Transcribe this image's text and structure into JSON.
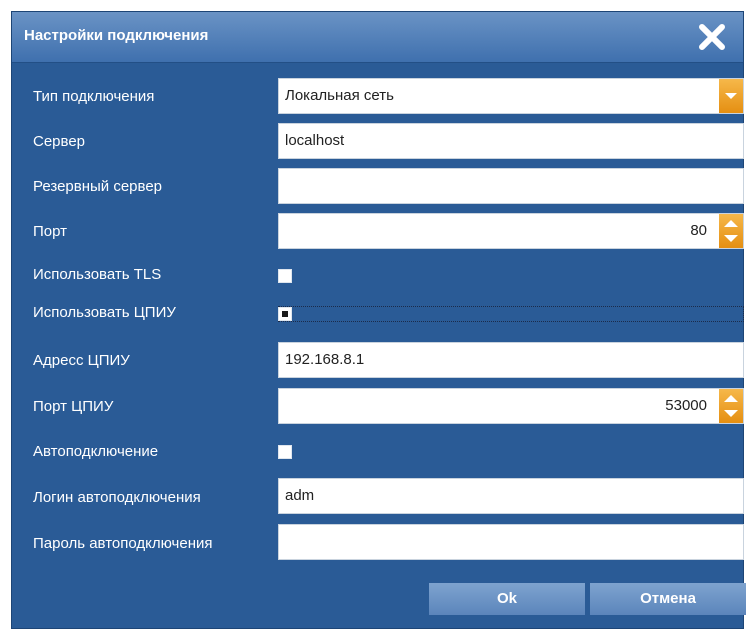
{
  "dialog": {
    "title": "Настройки подключения"
  },
  "fields": {
    "connection_type": {
      "label": "Тип подключения",
      "value": "Локальная сеть"
    },
    "server": {
      "label": "Сервер",
      "value": "localhost"
    },
    "backup_server": {
      "label": "Резервный сервер",
      "value": ""
    },
    "port": {
      "label": "Порт",
      "value": "80"
    },
    "use_tls": {
      "label": "Использовать TLS",
      "checked": false
    },
    "use_cpiu": {
      "label": "Использовать ЦПИУ",
      "checked": true
    },
    "cpiu_address": {
      "label": "Адресс ЦПИУ",
      "value": "192.168.8.1"
    },
    "cpiu_port": {
      "label": "Порт ЦПИУ",
      "value": "53000"
    },
    "autoconnect": {
      "label": "Автоподключение",
      "checked": false
    },
    "autoconnect_login": {
      "label": "Логин автоподключения",
      "value": "adm"
    },
    "autoconnect_password": {
      "label": "Пароль автоподключения",
      "value": ""
    }
  },
  "buttons": {
    "ok": "Ok",
    "cancel": "Отмена"
  },
  "icons": {
    "close": "close-icon",
    "dropdown": "chevron-down-icon",
    "spinner": "spinner-arrows-icon"
  },
  "colors": {
    "dialog_bg": "#2a5b96",
    "title_gradient_top": "#6a93c5",
    "accent_orange": "#f0a22c",
    "button": "#6e96c8"
  }
}
